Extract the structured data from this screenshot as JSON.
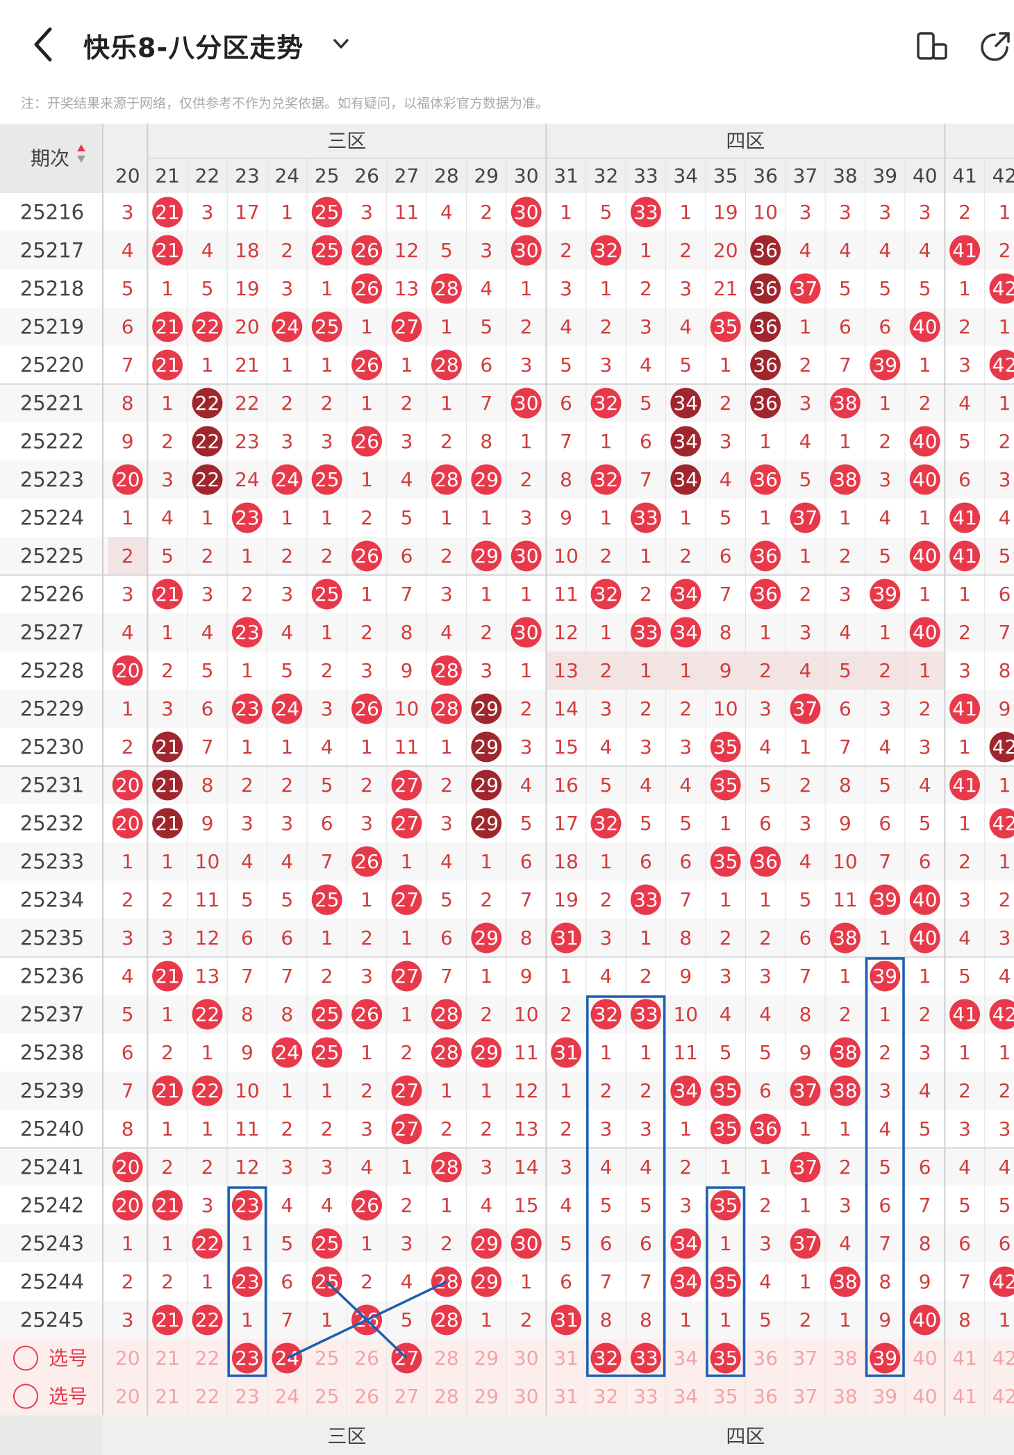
{
  "header": {
    "title": "快乐8-八分区走势",
    "note": "注：开奖结果来源于网络，仅供参考不作为兑奖依据。如有疑问，以福体彩官方数据为准。",
    "back_icon": "back-arrow-icon",
    "dropdown_icon": "chevron-down-icon",
    "right_icons": [
      "rotate-screen-icon",
      "share-icon"
    ]
  },
  "table": {
    "issue_header": "期次",
    "sort_icon": "sort-arrows-icon",
    "zone_labels": [
      "三区",
      "四区"
    ],
    "columns": [
      20,
      21,
      22,
      23,
      24,
      25,
      26,
      27,
      28,
      29,
      30,
      31,
      32,
      33,
      34,
      35,
      36,
      37,
      38,
      39,
      40,
      41,
      42
    ],
    "issues": [
      "25216",
      "25217",
      "25218",
      "25219",
      "25220",
      "25221",
      "25222",
      "25223",
      "25224",
      "25225",
      "25226",
      "25227",
      "25228",
      "25229",
      "25230",
      "25231",
      "25232",
      "25233",
      "25234",
      "25235",
      "25236",
      "25237",
      "25238",
      "25239",
      "25240",
      "25241",
      "25242",
      "25243",
      "25244",
      "25245"
    ],
    "rows": [
      [
        "3",
        "#21",
        "3",
        "17",
        "1",
        "#25",
        "3",
        "11",
        "4",
        "2",
        "#30",
        "1",
        "5",
        "#33",
        "1",
        "19",
        "10",
        "3",
        "3",
        "3",
        "3",
        "2",
        "1"
      ],
      [
        "4",
        "#21",
        "4",
        "18",
        "2",
        "#25",
        "#26",
        "12",
        "5",
        "3",
        "#30",
        "2",
        "#32",
        "1",
        "2",
        "20",
        "D36",
        "4",
        "4",
        "4",
        "4",
        "#41",
        "2"
      ],
      [
        "5",
        "1",
        "5",
        "19",
        "3",
        "1",
        "#26",
        "13",
        "#28",
        "4",
        "1",
        "3",
        "1",
        "2",
        "3",
        "21",
        "D36",
        "#37",
        "5",
        "5",
        "5",
        "1",
        "#42"
      ],
      [
        "6",
        "#21",
        "#22",
        "20",
        "#24",
        "#25",
        "1",
        "#27",
        "1",
        "5",
        "2",
        "4",
        "2",
        "3",
        "4",
        "#35",
        "D36",
        "1",
        "6",
        "6",
        "#40",
        "2",
        "1"
      ],
      [
        "7",
        "#21",
        "1",
        "21",
        "1",
        "1",
        "#26",
        "1",
        "#28",
        "6",
        "3",
        "5",
        "3",
        "4",
        "5",
        "1",
        "D36",
        "2",
        "7",
        "#39",
        "1",
        "3",
        "#42"
      ],
      [
        "8",
        "1",
        "D22",
        "22",
        "2",
        "2",
        "1",
        "2",
        "1",
        "7",
        "#30",
        "6",
        "#32",
        "5",
        "D34",
        "2",
        "D36",
        "3",
        "#38",
        "1",
        "2",
        "4",
        "1"
      ],
      [
        "9",
        "2",
        "D22",
        "23",
        "3",
        "3",
        "#26",
        "3",
        "2",
        "8",
        "1",
        "7",
        "1",
        "6",
        "D34",
        "3",
        "1",
        "4",
        "1",
        "2",
        "#40",
        "5",
        "2"
      ],
      [
        "#20",
        "3",
        "D22",
        "24",
        "#24",
        "#25",
        "1",
        "4",
        "#28",
        "#29",
        "2",
        "8",
        "#32",
        "7",
        "D34",
        "4",
        "#36",
        "5",
        "#38",
        "3",
        "#40",
        "6",
        "3"
      ],
      [
        "1",
        "4",
        "1",
        "#23",
        "1",
        "1",
        "2",
        "5",
        "1",
        "1",
        "3",
        "9",
        "1",
        "#33",
        "1",
        "5",
        "1",
        "#37",
        "1",
        "4",
        "1",
        "#41",
        "4"
      ],
      [
        "2",
        "5",
        "2",
        "1",
        "2",
        "2",
        "#26",
        "6",
        "2",
        "#29",
        "#30",
        "10",
        "2",
        "1",
        "2",
        "6",
        "#36",
        "1",
        "2",
        "5",
        "#40",
        "#41",
        "5"
      ],
      [
        "3",
        "#21",
        "3",
        "2",
        "3",
        "#25",
        "1",
        "7",
        "3",
        "1",
        "1",
        "11",
        "#32",
        "2",
        "#34",
        "7",
        "#36",
        "2",
        "3",
        "#39",
        "1",
        "1",
        "6"
      ],
      [
        "4",
        "1",
        "4",
        "#23",
        "4",
        "1",
        "2",
        "8",
        "4",
        "2",
        "#30",
        "12",
        "1",
        "#33",
        "#34",
        "8",
        "1",
        "3",
        "4",
        "1",
        "#40",
        "2",
        "7"
      ],
      [
        "#20",
        "2",
        "5",
        "1",
        "5",
        "2",
        "3",
        "9",
        "#28",
        "3",
        "1",
        "13",
        "2",
        "1",
        "1",
        "9",
        "2",
        "4",
        "5",
        "2",
        "1",
        "3",
        "8"
      ],
      [
        "1",
        "3",
        "6",
        "#23",
        "#24",
        "3",
        "#26",
        "10",
        "#28",
        "D29",
        "2",
        "14",
        "3",
        "2",
        "2",
        "10",
        "3",
        "#37",
        "6",
        "3",
        "2",
        "#41",
        "9"
      ],
      [
        "2",
        "D21",
        "7",
        "1",
        "1",
        "4",
        "1",
        "11",
        "1",
        "D29",
        "3",
        "15",
        "4",
        "3",
        "3",
        "#35",
        "4",
        "1",
        "7",
        "4",
        "3",
        "1",
        "D42"
      ],
      [
        "#20",
        "D21",
        "8",
        "2",
        "2",
        "5",
        "2",
        "#27",
        "2",
        "D29",
        "4",
        "16",
        "5",
        "4",
        "4",
        "#35",
        "5",
        "2",
        "8",
        "5",
        "4",
        "#41",
        "1"
      ],
      [
        "#20",
        "D21",
        "9",
        "3",
        "3",
        "6",
        "3",
        "#27",
        "3",
        "D29",
        "5",
        "17",
        "#32",
        "5",
        "5",
        "1",
        "6",
        "3",
        "9",
        "6",
        "5",
        "1",
        "#42"
      ],
      [
        "1",
        "1",
        "10",
        "4",
        "4",
        "7",
        "#26",
        "1",
        "4",
        "1",
        "6",
        "18",
        "1",
        "6",
        "6",
        "#35",
        "#36",
        "4",
        "10",
        "7",
        "6",
        "2",
        "1"
      ],
      [
        "2",
        "2",
        "11",
        "5",
        "5",
        "#25",
        "1",
        "#27",
        "5",
        "2",
        "7",
        "19",
        "2",
        "#33",
        "7",
        "1",
        "1",
        "5",
        "11",
        "#39",
        "#40",
        "3",
        "2"
      ],
      [
        "3",
        "3",
        "12",
        "6",
        "6",
        "1",
        "2",
        "1",
        "6",
        "#29",
        "8",
        "#31",
        "3",
        "1",
        "8",
        "2",
        "2",
        "6",
        "#38",
        "1",
        "#40",
        "4",
        "3"
      ],
      [
        "4",
        "#21",
        "13",
        "7",
        "7",
        "2",
        "3",
        "#27",
        "7",
        "1",
        "9",
        "1",
        "4",
        "2",
        "9",
        "3",
        "3",
        "7",
        "1",
        "#39",
        "1",
        "5",
        "4"
      ],
      [
        "5",
        "1",
        "#22",
        "8",
        "8",
        "#25",
        "#26",
        "1",
        "#28",
        "2",
        "10",
        "2",
        "#32",
        "#33",
        "10",
        "4",
        "4",
        "8",
        "2",
        "1",
        "2",
        "#41",
        "#42"
      ],
      [
        "6",
        "2",
        "1",
        "9",
        "#24",
        "#25",
        "1",
        "2",
        "#28",
        "#29",
        "11",
        "#31",
        "1",
        "1",
        "11",
        "5",
        "5",
        "9",
        "#38",
        "2",
        "3",
        "1",
        "1"
      ],
      [
        "7",
        "#21",
        "#22",
        "10",
        "1",
        "1",
        "2",
        "#27",
        "1",
        "1",
        "12",
        "1",
        "2",
        "2",
        "#34",
        "#35",
        "6",
        "#37",
        "#38",
        "3",
        "4",
        "2",
        "2"
      ],
      [
        "8",
        "1",
        "1",
        "11",
        "2",
        "2",
        "3",
        "#27",
        "2",
        "2",
        "13",
        "2",
        "3",
        "3",
        "1",
        "#35",
        "#36",
        "1",
        "1",
        "4",
        "5",
        "3",
        "3"
      ],
      [
        "#20",
        "2",
        "2",
        "12",
        "3",
        "3",
        "4",
        "1",
        "#28",
        "3",
        "14",
        "3",
        "4",
        "4",
        "2",
        "1",
        "1",
        "#37",
        "2",
        "5",
        "6",
        "4",
        "4"
      ],
      [
        "#20",
        "#21",
        "3",
        "#23",
        "4",
        "4",
        "#26",
        "2",
        "1",
        "4",
        "15",
        "4",
        "5",
        "5",
        "3",
        "#35",
        "2",
        "1",
        "3",
        "6",
        "7",
        "5",
        "5"
      ],
      [
        "1",
        "1",
        "#22",
        "1",
        "5",
        "#25",
        "1",
        "3",
        "2",
        "#29",
        "#30",
        "5",
        "6",
        "6",
        "#34",
        "1",
        "3",
        "#37",
        "4",
        "7",
        "8",
        "6",
        "6"
      ],
      [
        "2",
        "2",
        "1",
        "#23",
        "6",
        "#25",
        "2",
        "4",
        "#28",
        "#29",
        "1",
        "6",
        "7",
        "7",
        "#34",
        "#35",
        "4",
        "1",
        "#38",
        "8",
        "9",
        "7",
        "#42"
      ],
      [
        "3",
        "#21",
        "#22",
        "1",
        "7",
        "1",
        "#26",
        "5",
        "#28",
        "1",
        "2",
        "#31",
        "8",
        "8",
        "1",
        "1",
        "5",
        "2",
        "1",
        "9",
        "#40",
        "8",
        "1"
      ]
    ],
    "select_label": "选号",
    "select_marked_row1": [
      23,
      24,
      27,
      32,
      33,
      35,
      39
    ],
    "footer_zone_labels": [
      "三区",
      "四区"
    ],
    "colors": {
      "red_ball": "#e8394a",
      "dark_ball": "#a0262d",
      "number_text": "#d23c3c",
      "row_alt": "#f7f7f7",
      "select_bg": "#fdeeee",
      "annotation": "#1a5fb4"
    }
  }
}
